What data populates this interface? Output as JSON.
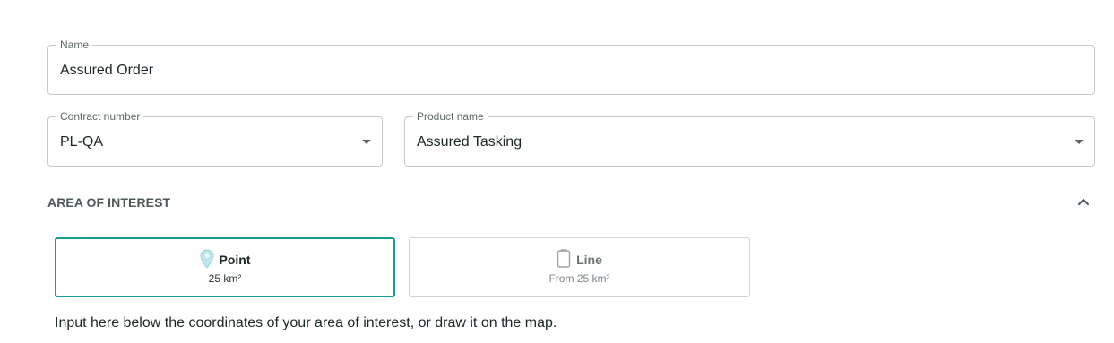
{
  "form": {
    "name": {
      "label": "Name",
      "value": "Assured Order"
    },
    "contract": {
      "label": "Contract number",
      "value": "PL-QA"
    },
    "product": {
      "label": "Product name",
      "value": "Assured Tasking"
    }
  },
  "area_of_interest": {
    "title": "AREA OF INTEREST",
    "collapse_icon": "chevron-up-icon",
    "options": [
      {
        "title": "Point",
        "subtitle": "25 km²",
        "icon": "map-pin-icon",
        "selected": true
      },
      {
        "title": "Line",
        "subtitle": "From 25 km²",
        "icon": "polyline-icon",
        "selected": false
      }
    ],
    "help_text": "Input here below the coordinates of your area of interest, or draw it on the map."
  },
  "colors": {
    "accent": "#1b9b96",
    "border": "#c4c9c9",
    "text": "#1b2626",
    "muted": "#5d6868"
  }
}
